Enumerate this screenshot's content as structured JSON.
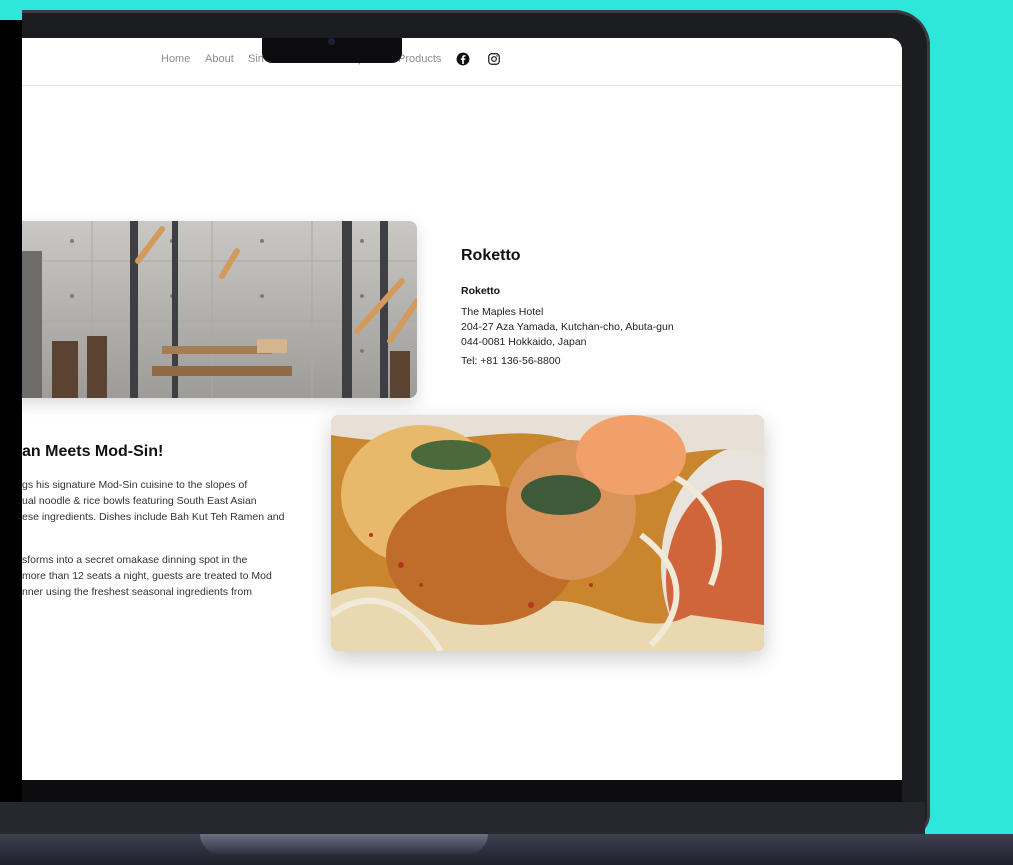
{
  "nav": {
    "links": [
      "Home",
      "About",
      "Sin",
      "p",
      "Products"
    ],
    "social": [
      "facebook-icon",
      "instagram-icon"
    ]
  },
  "venue": {
    "title": "Roketto",
    "subtitle": "Roketto",
    "address": [
      "The Maples Hotel",
      "204-27 Aza Yamada, Kutchan-cho, Abuta-gun",
      "044-0081 Hokkaido, Japan"
    ],
    "tel": "Tel: +81 136-56-8800"
  },
  "about": {
    "title": "an Meets Mod-Sin!",
    "para1": [
      "gs his signature Mod-Sin cuisine to the slopes of",
      "ual noodle & rice bowls featuring South East Asian",
      "ese ingredients. Dishes include Bah Kut Teh Ramen and"
    ],
    "para2": [
      "sforms into a secret omakase dinning spot in the",
      " more than 12 seats a night, guests are treated to Mod",
      "nner using the freshest seasonal ingredients from"
    ]
  },
  "colors": {
    "background": "#2ee6d9",
    "screen": "#ffffff"
  }
}
